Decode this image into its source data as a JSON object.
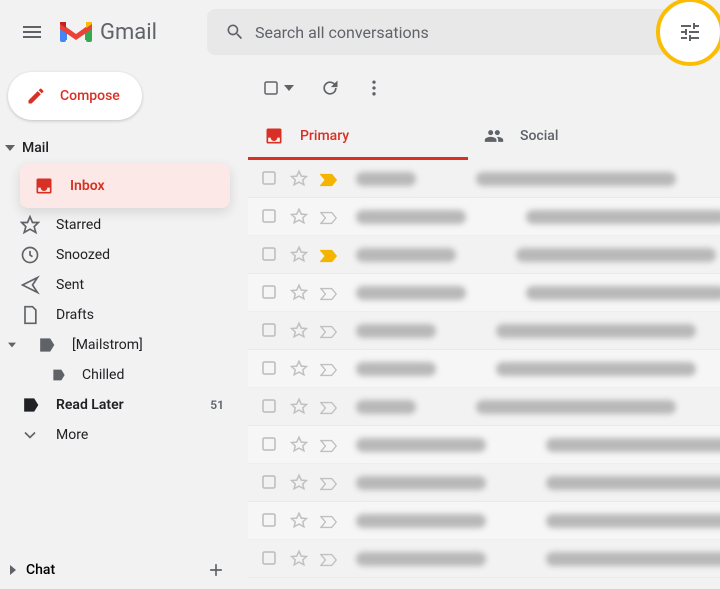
{
  "header": {
    "app_name": "Gmail",
    "search_placeholder": "Search all conversations"
  },
  "compose_label": "Compose",
  "nav_section_mail": "Mail",
  "nav": {
    "inbox": "Inbox",
    "starred": "Starred",
    "snoozed": "Snoozed",
    "sent": "Sent",
    "drafts": "Drafts",
    "mailstrom": "[Mailstrom]",
    "chilled": "Chilled",
    "read_later": "Read Later",
    "read_later_count": "51",
    "more": "More"
  },
  "chat_label": "Chat",
  "tabs": {
    "primary": "Primary",
    "social": "Social"
  },
  "emails": [
    {
      "important": true
    },
    {
      "important": false
    },
    {
      "important": true
    },
    {
      "important": false
    },
    {
      "important": false
    },
    {
      "important": false
    },
    {
      "important": false
    },
    {
      "important": false
    },
    {
      "important": false
    },
    {
      "important": false
    },
    {
      "important": false
    }
  ]
}
